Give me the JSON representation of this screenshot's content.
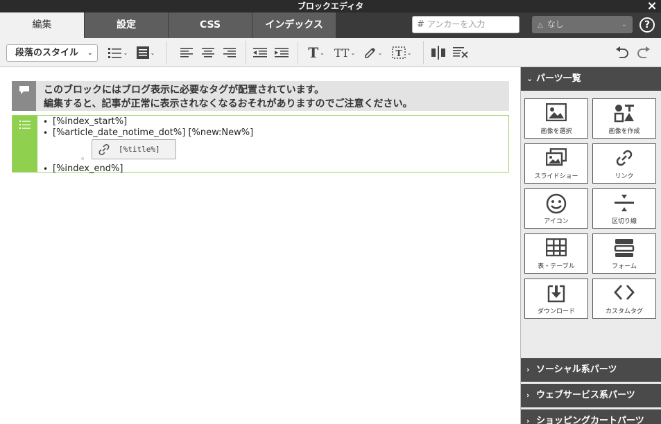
{
  "window": {
    "title": "ブロックエディタ",
    "close_label": "×"
  },
  "tabs": [
    {
      "label": "編集",
      "active": true
    },
    {
      "label": "設定",
      "active": false
    },
    {
      "label": "CSS",
      "active": false
    },
    {
      "label": "インデックス",
      "active": false
    }
  ],
  "header": {
    "anchor_placeholder": "アンカーを入力",
    "anchor_prefix": "#",
    "selector_value": "なし",
    "help_label": "?"
  },
  "toolbar": {
    "paragraph_style_label": "段落のスタイル"
  },
  "notice": {
    "line1": "このブロックにはブログ表示に必要なタグが配置されています。",
    "line2": "編集すると、記事が正常に表示されなくなるおそれがありますのでご注意ください。"
  },
  "block": {
    "items": [
      "[%index_start%]",
      "[%article_date_notime_dot%] [%new:New%]",
      "[%index_end%]"
    ],
    "sub_bullet": "◦",
    "link_chip_text": "[%title%]"
  },
  "sidebar": {
    "parts_title": "パーツ一覧",
    "parts": [
      {
        "label": "画像を選択",
        "icon": "image-select-icon"
      },
      {
        "label": "画像を作成",
        "icon": "image-create-icon"
      },
      {
        "label": "スライドショー",
        "icon": "slideshow-icon"
      },
      {
        "label": "リンク",
        "icon": "link-icon"
      },
      {
        "label": "アイコン",
        "icon": "smiley-icon"
      },
      {
        "label": "区切り線",
        "icon": "divider-icon"
      },
      {
        "label": "表・テーブル",
        "icon": "table-icon"
      },
      {
        "label": "フォーム",
        "icon": "form-icon"
      },
      {
        "label": "ダウンロード",
        "icon": "download-icon"
      },
      {
        "label": "カスタムタグ",
        "icon": "custom-tag-icon"
      }
    ],
    "sections": [
      {
        "label": "ソーシャル系パーツ"
      },
      {
        "label": "ウェブサービス系パーツ"
      },
      {
        "label": "ショッピングカートパーツ"
      }
    ]
  },
  "colors": {
    "accent_green": "#8fd14f",
    "dark_header": "#4a4a4a",
    "tab_inactive": "#5e5e5e"
  }
}
